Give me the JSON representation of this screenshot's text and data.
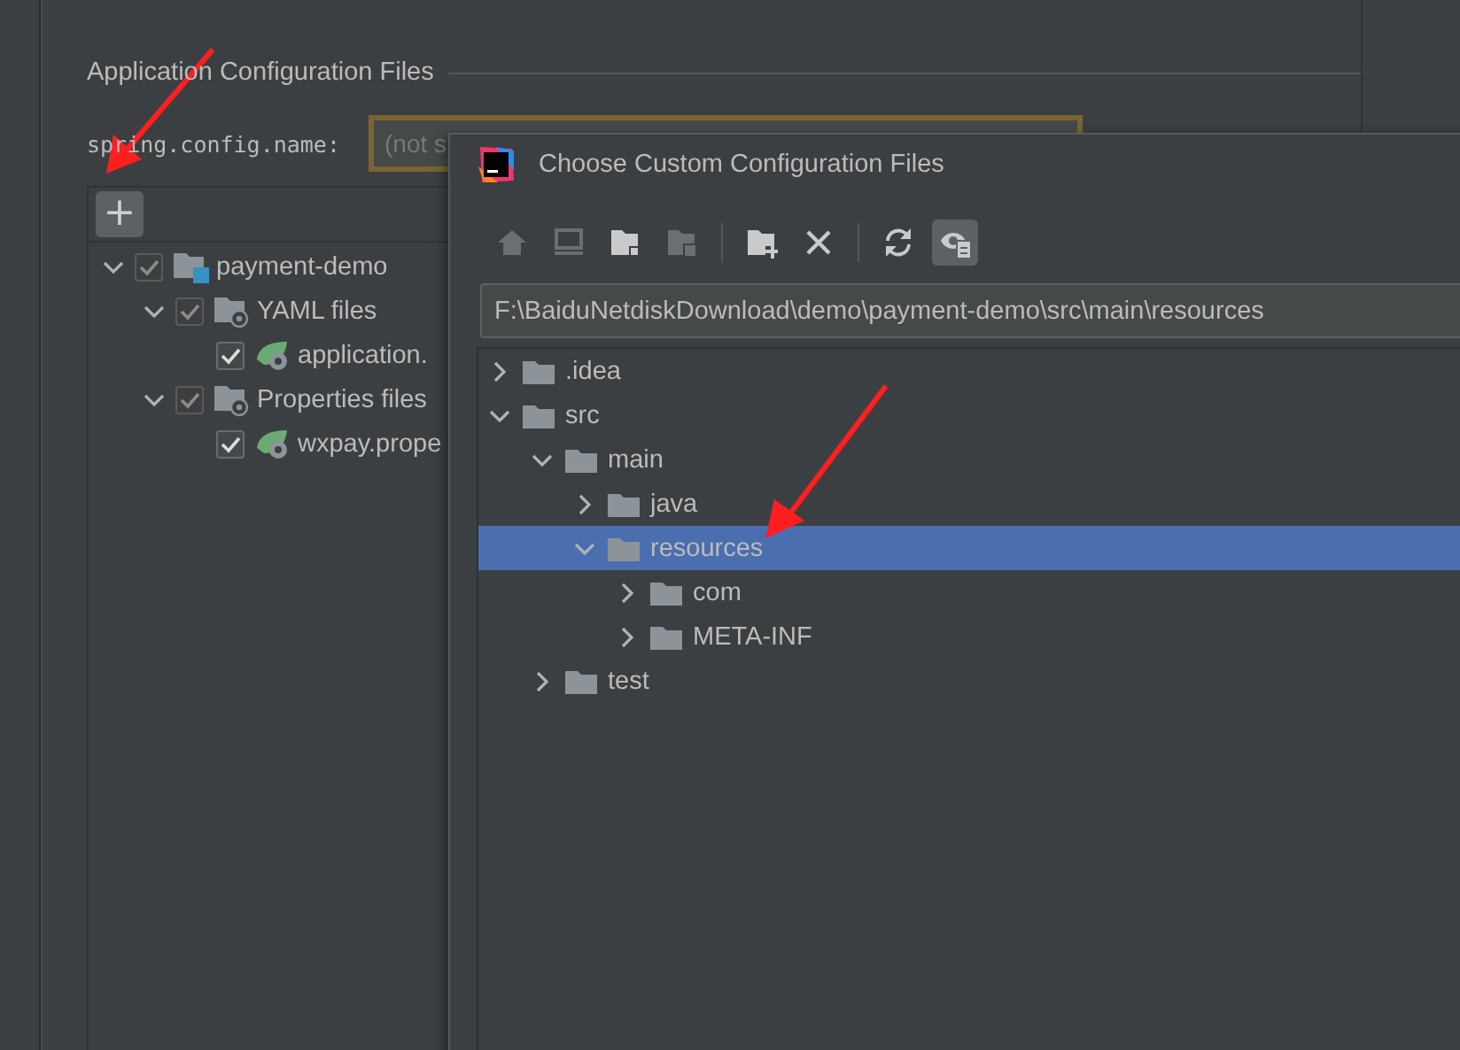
{
  "settings": {
    "section_title": "Application Configuration Files",
    "config_name": {
      "label": "spring.config.name:",
      "placeholder": "(not s"
    },
    "add_button": {
      "label": "+"
    },
    "tree": [
      {
        "kind": "project",
        "label": "payment-demo",
        "checked": true,
        "expanded": true,
        "children": [
          {
            "kind": "group",
            "label": "YAML files",
            "checked": true,
            "expanded": true,
            "children": [
              {
                "kind": "file",
                "label": "application.",
                "checked": true
              }
            ]
          },
          {
            "kind": "group",
            "label": "Properties files",
            "checked": true,
            "expanded": true,
            "children": [
              {
                "kind": "file",
                "label": "wxpay.prope",
                "checked": true
              }
            ]
          }
        ]
      }
    ]
  },
  "dialog": {
    "title": "Choose Custom Configuration Files",
    "toolbar": [
      {
        "kind": "home",
        "disabled": true,
        "selected": false
      },
      {
        "kind": "computer",
        "disabled": true,
        "selected": false
      },
      {
        "kind": "project-folder",
        "disabled": false,
        "selected": false
      },
      {
        "kind": "module-folder",
        "disabled": true,
        "selected": false
      },
      {
        "kind": "separator"
      },
      {
        "kind": "new-folder",
        "disabled": false,
        "selected": false
      },
      {
        "kind": "delete",
        "disabled": false,
        "selected": false
      },
      {
        "kind": "separator"
      },
      {
        "kind": "refresh",
        "disabled": false,
        "selected": false
      },
      {
        "kind": "show-hidden",
        "disabled": false,
        "selected": true
      }
    ],
    "path": "F:\\BaiduNetdiskDownload\\demo\\payment-demo\\src\\main\\resources",
    "tree": [
      {
        "label": ".idea",
        "expanded": false,
        "selected": false
      },
      {
        "label": "src",
        "expanded": true,
        "selected": false,
        "children": [
          {
            "label": "main",
            "expanded": true,
            "selected": false,
            "children": [
              {
                "label": "java",
                "expanded": false,
                "selected": false
              },
              {
                "label": "resources",
                "expanded": true,
                "selected": true,
                "children": [
                  {
                    "label": "com",
                    "expanded": false,
                    "selected": false
                  },
                  {
                    "label": "META-INF",
                    "expanded": false,
                    "selected": false
                  }
                ]
              }
            ]
          },
          {
            "label": "test",
            "expanded": false,
            "selected": false
          }
        ]
      }
    ]
  }
}
